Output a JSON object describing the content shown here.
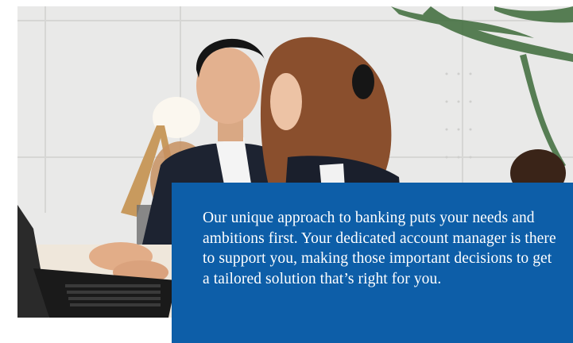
{
  "hero_image": {
    "description_icon": "photo-people-at-laptop"
  },
  "info_card": {
    "text": "Our unique approach to banking puts your needs and ambitions first. Your dedicated account manager is there to support you, making those important decisions to get a tailored solution that’s right for you.",
    "background_color": "#0d5ea8",
    "text_color": "#ffffff"
  }
}
